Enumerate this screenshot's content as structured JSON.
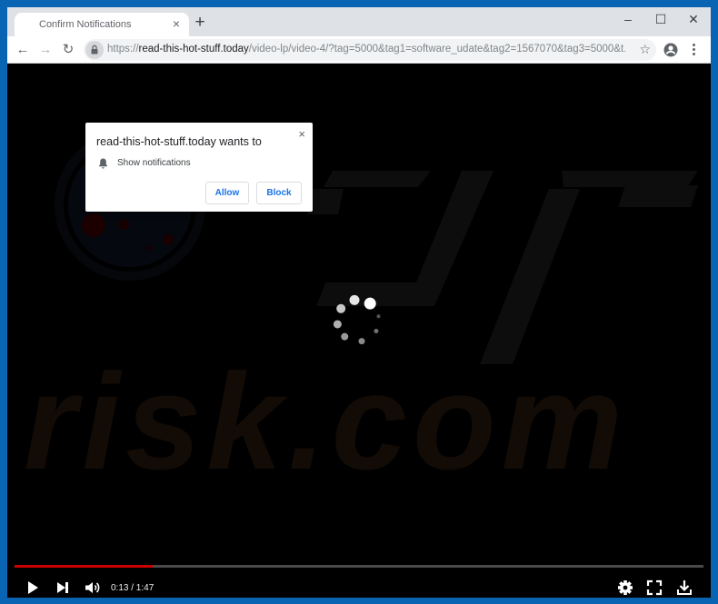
{
  "browser": {
    "tab": {
      "title": "Confirm Notifications",
      "close_glyph": "×"
    },
    "new_tab_glyph": "+",
    "window": {
      "minimize_glyph": "–",
      "maximize_glyph": "☐",
      "close_glyph": "✕"
    },
    "nav": {
      "back_glyph": "←",
      "forward_glyph": "→",
      "reload_glyph": "↻"
    },
    "url": {
      "scheme": "https://",
      "host": "read-this-hot-stuff.today",
      "path": "/video-lp/video-4/?tag=5000&tag1=software_udate&tag2=1567070&tag3=5000&t..."
    },
    "bookmark_glyph": "☆"
  },
  "popup": {
    "title": "read-this-hot-stuff.today wants to",
    "permission": "Show notifications",
    "close_glyph": "×",
    "allow_label": "Allow",
    "block_label": "Block",
    "accent": "#1a73e8"
  },
  "player": {
    "time": "0:13 / 1:47",
    "progress_fraction": 0.2,
    "progress_color": "#cc0000",
    "state": "loading"
  },
  "watermark": {
    "text": "PC risk.com"
  },
  "colors": {
    "desktop": "#0a64b4",
    "tabstrip": "#dee1e6"
  }
}
